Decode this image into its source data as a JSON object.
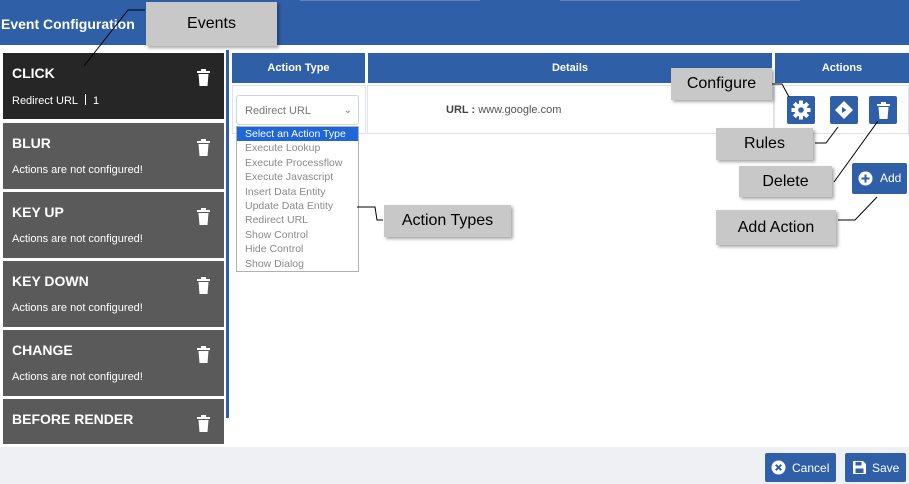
{
  "header": {
    "title": "Event Configuration"
  },
  "events": [
    {
      "name": "CLICK",
      "action": "Redirect URL",
      "count": "1",
      "active": true
    },
    {
      "name": "BLUR",
      "desc": "Actions are not configured!"
    },
    {
      "name": "KEY UP",
      "desc": "Actions are not configured!"
    },
    {
      "name": "KEY DOWN",
      "desc": "Actions are not configured!"
    },
    {
      "name": "CHANGE",
      "desc": "Actions are not configured!"
    },
    {
      "name": "BEFORE RENDER"
    }
  ],
  "table": {
    "columns": [
      "Action Type",
      "Details",
      "Actions"
    ],
    "row": {
      "action_type": "Redirect URL",
      "details_label": "URL :",
      "details_value": "www.google.com"
    }
  },
  "dropdown": {
    "selected": "Select an Action Type",
    "options": [
      "Execute Lookup",
      "Execute Processflow",
      "Execute Javascript",
      "Insert Data Entity",
      "Update Data Entity",
      "Redirect URL",
      "Show Control",
      "Hide Control",
      "Show Dialog"
    ]
  },
  "buttons": {
    "add": "Add",
    "cancel": "Cancel",
    "save": "Save"
  },
  "callouts": {
    "events": "Events",
    "configure": "Configure",
    "rules": "Rules",
    "delete": "Delete",
    "action_types": "Action Types",
    "add_action": "Add Action"
  },
  "icons": {
    "trash": "trash-icon",
    "configure": "gear-icon",
    "rules": "diamond-rules-icon",
    "delete": "trash-icon",
    "add": "plus-circle-icon",
    "cancel": "x-circle-icon",
    "save": "floppy-disk-icon",
    "select": "chevron-down-icon"
  },
  "colors": {
    "primary": "#2f5fa6",
    "event_card": "#5a5a5a",
    "event_card_active": "#262626",
    "dropdown_selected": "#1f66d8",
    "callout": "#c8c8c8"
  }
}
